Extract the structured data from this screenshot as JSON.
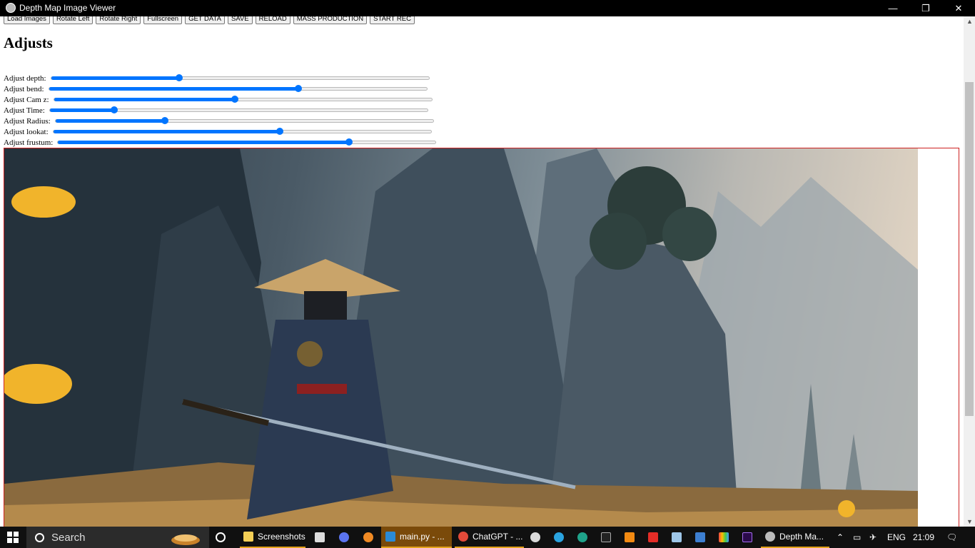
{
  "window": {
    "title": "Depth Map Image Viewer",
    "controls": [
      "—",
      "❐",
      "✕"
    ]
  },
  "toolbar": {
    "buttons": [
      "Load Images",
      "Rotate Left",
      "Rotate Right",
      "Fullscreen",
      "GET DATA",
      "SAVE",
      "RELOAD",
      "MASS PRODUCTION",
      "START REC"
    ]
  },
  "heading": "Adjusts",
  "sliders": [
    {
      "label": "Adjust depth:",
      "value": 0.34
    },
    {
      "label": "Adjust bend:",
      "value": 0.66
    },
    {
      "label": "Adjust Cam z:",
      "value": 0.48
    },
    {
      "label": "Adjust Time:",
      "value": 0.17
    },
    {
      "label": "Adjust Radius:",
      "value": 0.29
    },
    {
      "label": "Adjust lookat:",
      "value": 0.6
    },
    {
      "label": "Adjust frustum:",
      "value": 0.77
    }
  ],
  "taskbar": {
    "search_placeholder": "Search",
    "items": [
      {
        "label": "Screenshots",
        "icon": "folder-icon"
      },
      {
        "label": "main.py - ...",
        "icon": "vscode-icon"
      },
      {
        "label": "ChatGPT - ...",
        "icon": "chrome-icon"
      },
      {
        "label": "Depth Ma...",
        "icon": "app-icon"
      }
    ],
    "language": "ENG",
    "time": "21:09"
  },
  "colors": {
    "accent": "#0075ff",
    "frame_border": "#cc2020",
    "taskbar_bg": "#101010"
  }
}
